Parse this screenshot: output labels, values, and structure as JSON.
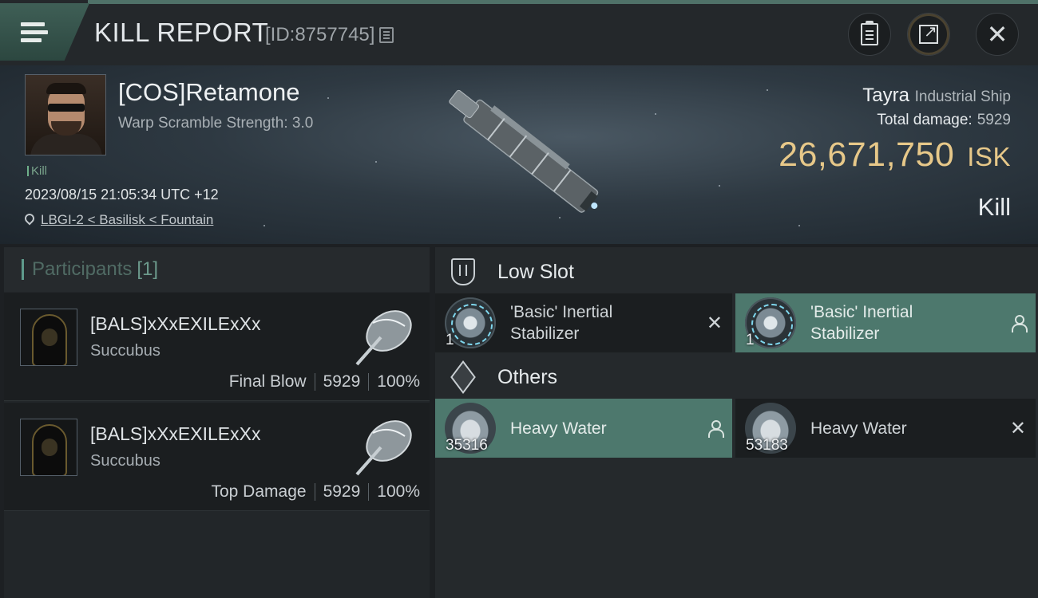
{
  "header": {
    "title": "KILL REPORT",
    "report_id": "[ID:8757745]"
  },
  "victim": {
    "name": "[COS]Retamone",
    "warp_scramble": "Warp Scramble Strength: 3.0",
    "kill_tag": "Kill",
    "datetime": "2023/08/15 21:05:34 UTC +12",
    "location": "LBGI-2 < Basilisk < Fountain",
    "ship_name": "Tayra",
    "ship_class": "Industrial Ship",
    "total_damage_label": "Total damage:",
    "total_damage": "5929",
    "isk_value": "26,671,750",
    "isk_unit": "ISK",
    "result": "Kill"
  },
  "participants": {
    "label": "Participants",
    "count": "[1]",
    "rows": [
      {
        "name": "[BALS]xXxEXILExXx",
        "ship": "Succubus",
        "role": "Final Blow",
        "damage": "5929",
        "percent": "100%"
      },
      {
        "name": "[BALS]xXxEXILExXx",
        "ship": "Succubus",
        "role": "Top Damage",
        "damage": "5929",
        "percent": "100%"
      }
    ]
  },
  "sections": {
    "low_slot": {
      "title": "Low Slot",
      "items": [
        {
          "line1": "'Basic' Inertial",
          "line2": "Stabilizer",
          "qty": "1",
          "status": "destroyed"
        },
        {
          "line1": "'Basic' Inertial",
          "line2": "Stabilizer",
          "qty": "1",
          "status": "dropped"
        }
      ]
    },
    "others": {
      "title": "Others",
      "items": [
        {
          "name": "Heavy Water",
          "qty": "35316",
          "status": "dropped"
        },
        {
          "name": "Heavy Water",
          "qty": "53183",
          "status": "destroyed"
        }
      ]
    }
  },
  "colors": {
    "accent_teal": "#4d786d",
    "isk_gold": "#e7c889",
    "background": "#1d2023"
  }
}
